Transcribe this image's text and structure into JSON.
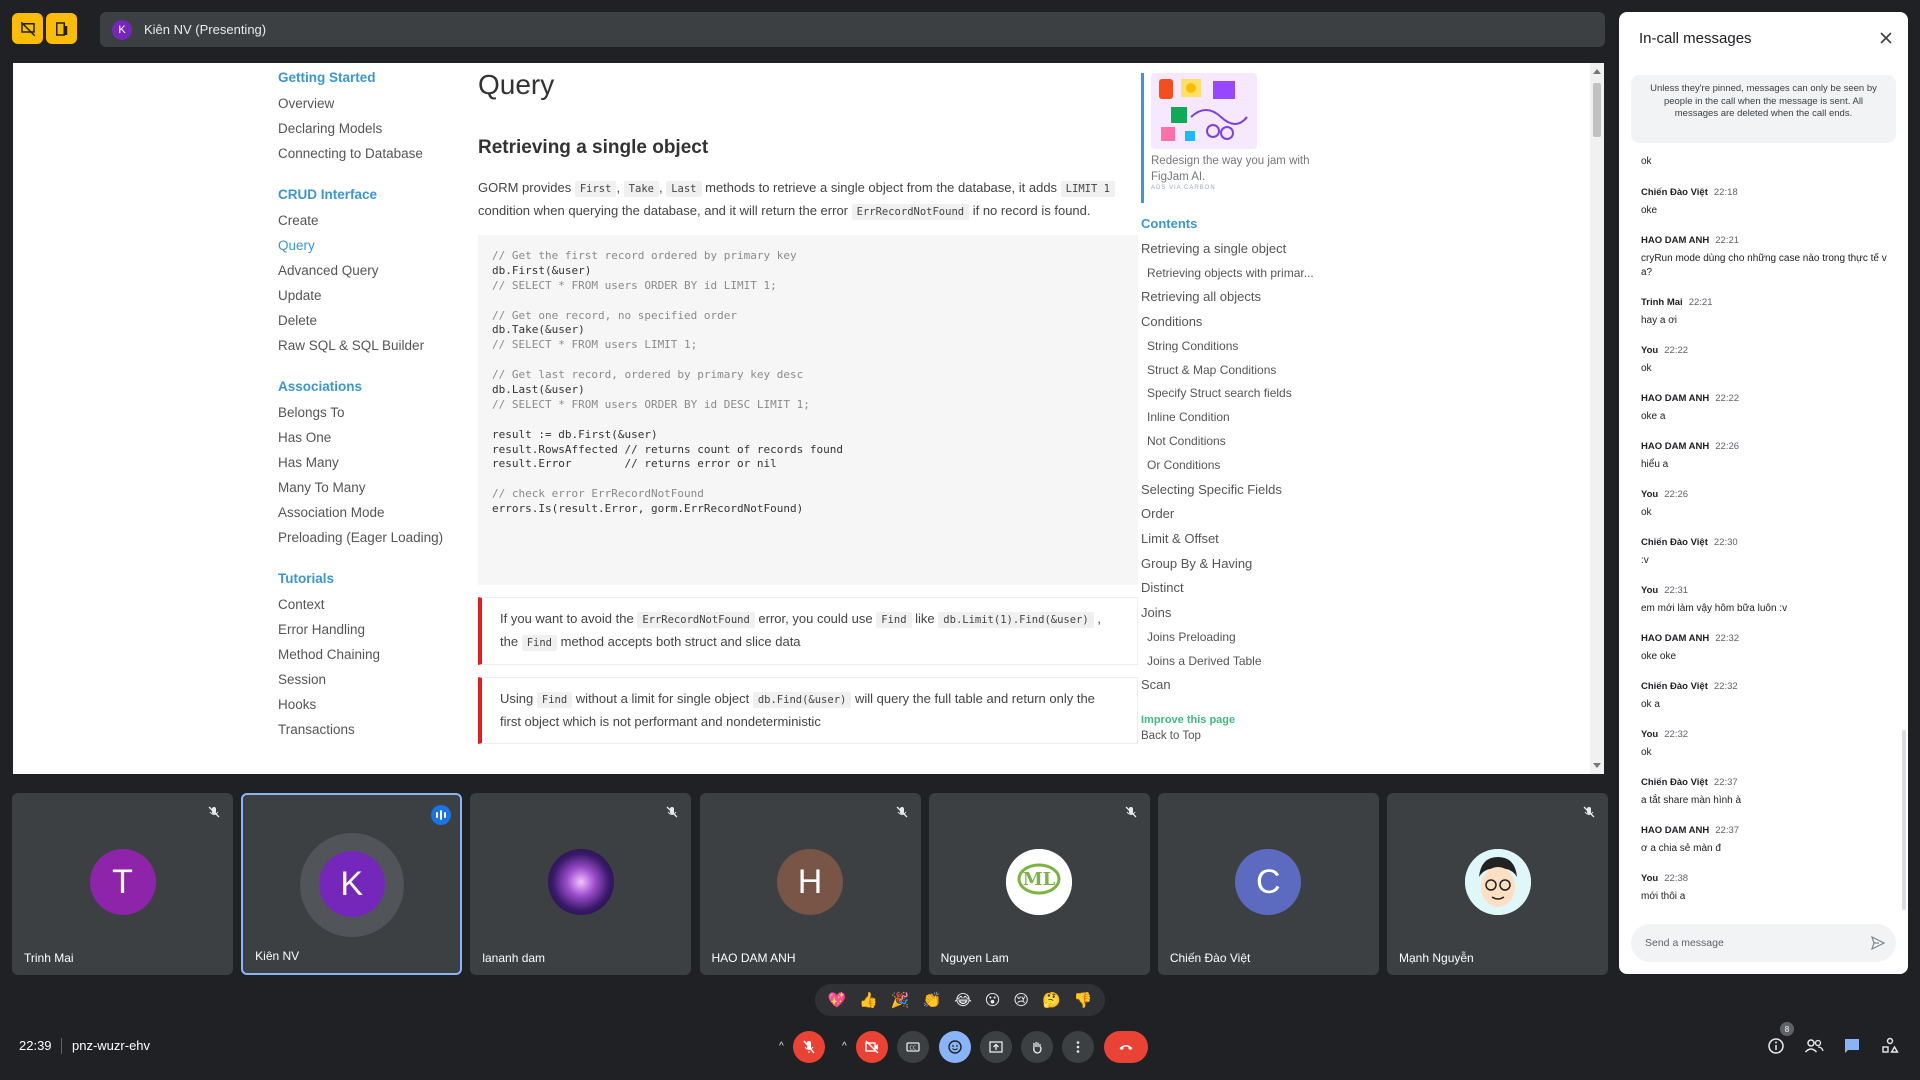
{
  "topbar": {
    "presenter_initial": "K",
    "presenter_label": "Kiên NV (Presenting)"
  },
  "shared_screen": {
    "nav": [
      {
        "heading": "Getting Started",
        "items": [
          "Overview",
          "Declaring Models",
          "Connecting to Database"
        ]
      },
      {
        "heading": "CRUD Interface",
        "items": [
          "Create",
          "Query",
          "Advanced Query",
          "Update",
          "Delete",
          "Raw SQL & SQL Builder"
        ]
      },
      {
        "heading": "Associations",
        "items": [
          "Belongs To",
          "Has One",
          "Has Many",
          "Many To Many",
          "Association Mode",
          "Preloading (Eager Loading)"
        ]
      },
      {
        "heading": "Tutorials",
        "items": [
          "Context",
          "Error Handling",
          "Method Chaining",
          "Session",
          "Hooks",
          "Transactions"
        ]
      }
    ],
    "active_nav": "Query",
    "page_title": "Query",
    "section_title": "Retrieving a single object",
    "intro": {
      "t1": "GORM provides",
      "c1": "First",
      "c2": "Take",
      "c3": "Last",
      "t2": "methods to retrieve a single object from the database, it adds",
      "c4": "LIMIT 1",
      "t3": "condition when querying the database, and it will return the error",
      "c5": "ErrRecordNotFound",
      "t4": "if no record is found."
    },
    "code_lines": [
      {
        "text": "// Get the first record ordered by primary key",
        "comment": true
      },
      {
        "text": "db.First(&user)",
        "comment": false
      },
      {
        "text": "// SELECT * FROM users ORDER BY id LIMIT 1;",
        "comment": true
      },
      {
        "text": "",
        "comment": false
      },
      {
        "text": "// Get one record, no specified order",
        "comment": true
      },
      {
        "text": "db.Take(&user)",
        "comment": false
      },
      {
        "text": "// SELECT * FROM users LIMIT 1;",
        "comment": true
      },
      {
        "text": "",
        "comment": false
      },
      {
        "text": "// Get last record, ordered by primary key desc",
        "comment": true
      },
      {
        "text": "db.Last(&user)",
        "comment": false
      },
      {
        "text": "// SELECT * FROM users ORDER BY id DESC LIMIT 1;",
        "comment": true
      },
      {
        "text": "",
        "comment": false
      },
      {
        "text": "result := db.First(&user)",
        "comment": false
      },
      {
        "text": "result.RowsAffected // returns count of records found",
        "comment": false
      },
      {
        "text": "result.Error        // returns error or nil",
        "comment": false
      },
      {
        "text": "",
        "comment": false
      },
      {
        "text": "// check error ErrRecordNotFound",
        "comment": true
      },
      {
        "text": "errors.Is(result.Error, gorm.ErrRecordNotFound)",
        "comment": false
      }
    ],
    "note1": {
      "t1": "If you want to avoid the",
      "c1": "ErrRecordNotFound",
      "t2": "error, you could use",
      "c2": "Find",
      "t3": "like",
      "c3": "db.Limit(1).Find(&user)",
      "t4": ", the",
      "c4": "Find",
      "t5": "method accepts both struct and slice data"
    },
    "note2": {
      "t1": "Using",
      "c1": "Find",
      "t2": "without a limit for single object",
      "c2": "db.Find(&user)",
      "t3": "will query the full table and return only the first object which is not performant and nondeterministic"
    },
    "ad": {
      "text": "Redesign the way you jam with FigJam AI.",
      "by": "ADS VIA CARBON"
    },
    "toc": {
      "title": "Contents",
      "items": [
        {
          "label": "Retrieving a single object",
          "sub": false
        },
        {
          "label": "Retrieving objects with primar...",
          "sub": true
        },
        {
          "label": "Retrieving all objects",
          "sub": false
        },
        {
          "label": "Conditions",
          "sub": false
        },
        {
          "label": "String Conditions",
          "sub": true
        },
        {
          "label": "Struct & Map Conditions",
          "sub": true
        },
        {
          "label": "Specify Struct search fields",
          "sub": true
        },
        {
          "label": "Inline Condition",
          "sub": true
        },
        {
          "label": "Not Conditions",
          "sub": true
        },
        {
          "label": "Or Conditions",
          "sub": true
        },
        {
          "label": "Selecting Specific Fields",
          "sub": false
        },
        {
          "label": "Order",
          "sub": false
        },
        {
          "label": "Limit & Offset",
          "sub": false
        },
        {
          "label": "Group By & Having",
          "sub": false
        },
        {
          "label": "Distinct",
          "sub": false
        },
        {
          "label": "Joins",
          "sub": false
        },
        {
          "label": "Joins Preloading",
          "sub": true
        },
        {
          "label": "Joins a Derived Table",
          "sub": true
        },
        {
          "label": "Scan",
          "sub": false
        }
      ],
      "improve": "Improve this page",
      "back_to_top": "Back to Top"
    }
  },
  "participants": [
    {
      "name": "Trinh Mai",
      "initial": "T",
      "color": "#8e24aa",
      "muted": true,
      "speaking": false
    },
    {
      "name": "Kiên NV",
      "initial": "K",
      "color": "#7627bb",
      "muted": false,
      "speaking": true
    },
    {
      "name": "lananh dam",
      "initial": "",
      "color": "#2a1b4a",
      "muted": true,
      "speaking": false,
      "icon": "galaxy-avatar"
    },
    {
      "name": "HAO DAM ANH",
      "initial": "H",
      "color": "#795548",
      "muted": true,
      "speaking": false
    },
    {
      "name": "Nguyen Lam",
      "initial": "",
      "color": "#ffffff",
      "muted": true,
      "speaking": false,
      "icon": "ml-logo-avatar"
    },
    {
      "name": "Chiến Đào Việt",
      "initial": "C",
      "color": "#5c6bc0",
      "muted": false,
      "speaking": false
    },
    {
      "name": "Mạnh Nguyễn",
      "initial": "",
      "color": "#e0f7fa",
      "muted": true,
      "speaking": false,
      "icon": "cartoon-face-avatar"
    }
  ],
  "chat": {
    "title": "In-call messages",
    "info": "Unless they're pinned, messages can only be seen by people in the call when the message is sent. All messages are deleted when the call ends.",
    "first_message": "ok",
    "messages": [
      {
        "author": "Chiến Đào Việt",
        "time": "22:18",
        "text": "oke"
      },
      {
        "author": "HAO DAM ANH",
        "time": "22:21",
        "text": "cryRun mode dùng cho những case nào trong thực tế v a?"
      },
      {
        "author": "Trinh Mai",
        "time": "22:21",
        "text": "hay a ơi"
      },
      {
        "author": "You",
        "time": "22:22",
        "text": "ok"
      },
      {
        "author": "HAO DAM ANH",
        "time": "22:22",
        "text": "oke a"
      },
      {
        "author": "HAO DAM ANH",
        "time": "22:26",
        "text": "hiểu a"
      },
      {
        "author": "You",
        "time": "22:26",
        "text": "ok"
      },
      {
        "author": "Chiến Đào Việt",
        "time": "22:30",
        "text": ":v"
      },
      {
        "author": "You",
        "time": "22:31",
        "text": "em mới làm vậy hôm bữa luôn :v"
      },
      {
        "author": "HAO DAM ANH",
        "time": "22:32",
        "text": "oke oke"
      },
      {
        "author": "Chiến Đào Việt",
        "time": "22:32",
        "text": "ok a"
      },
      {
        "author": "You",
        "time": "22:32",
        "text": "ok"
      },
      {
        "author": "Chiến Đào Việt",
        "time": "22:37",
        "text": "a tắt share màn hình à"
      },
      {
        "author": "HAO DAM ANH",
        "time": "22:37",
        "text": "ơ a chia sẻ màn đ"
      },
      {
        "author": "You",
        "time": "22:38",
        "text": "mới thôi a"
      }
    ],
    "input_placeholder": "Send a message"
  },
  "reactions": [
    "💖",
    "👍",
    "🎉",
    "👏",
    "😂",
    "😮",
    "😢",
    "🤔",
    "👎"
  ],
  "bottom": {
    "time": "22:39",
    "meeting_code": "pnz-wuzr-ehv",
    "people_count": "8"
  },
  "colors": {
    "accent": "#8ab4f8",
    "end_call": "#ea4335",
    "docs_link": "#3b96d3",
    "warn_border": "#e51c23"
  }
}
